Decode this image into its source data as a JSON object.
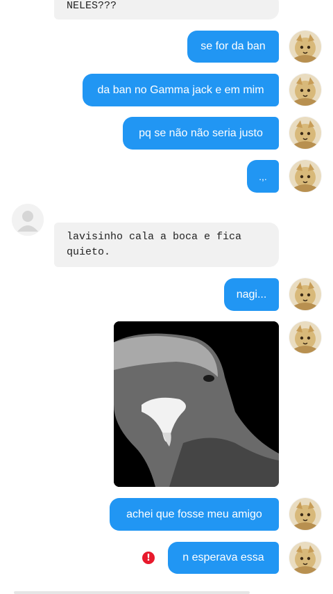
{
  "messages": {
    "in_top": "NELES???",
    "m1": "se for da ban",
    "m2": "da ban no Gamma jack e em mim",
    "m3": "pq se não não seria justo",
    "m4": ".,.",
    "in_mid": "lavisinho cala a boca e fica quieto.",
    "m5": "nagi...",
    "m6": "achei que fosse meu amigo",
    "m7": "n esperava essa"
  },
  "error_badge": "!",
  "colors": {
    "outgoing": "#2196f3",
    "incoming": "#f1f1f1",
    "error": "#e8192c"
  },
  "icons": {
    "self_avatar": "cat-avatar-icon",
    "other_avatar": "default-user-icon",
    "error": "error-icon"
  }
}
